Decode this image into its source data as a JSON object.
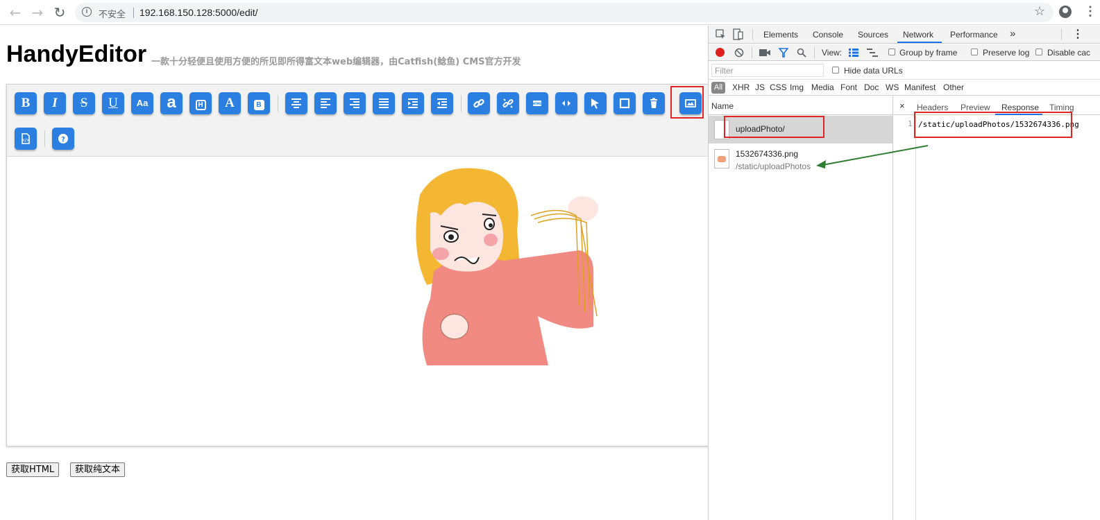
{
  "browser": {
    "url": "192.168.150.128:5000/edit/",
    "insecure_label": "不安全"
  },
  "page": {
    "title": "HandyEditor",
    "subtitle": "一款十分轻便且使用方便的所见即所得富文本web编辑器，由Catfish(鲶鱼) CMS官方开发",
    "buttons": {
      "get_html": "获取HTML",
      "get_text": "获取纯文本"
    },
    "toolbar": [
      {
        "name": "bold",
        "glyph": "B"
      },
      {
        "name": "italic",
        "glyph": "I"
      },
      {
        "name": "strikethrough",
        "glyph": "S"
      },
      {
        "name": "underline",
        "glyph": "U"
      },
      {
        "name": "font-size",
        "glyph": "Aa"
      },
      {
        "name": "font-family",
        "glyph": "a"
      },
      {
        "name": "heading",
        "glyph": "H"
      },
      {
        "name": "font-color",
        "glyph": "A"
      },
      {
        "name": "background-color",
        "glyph": "B"
      }
    ]
  },
  "devtools": {
    "tabs": [
      "Elements",
      "Console",
      "Sources",
      "Network",
      "Performance"
    ],
    "active_tab": "Network",
    "more_tabs": "»",
    "view_label": "View:",
    "group_by_frame": "Group by frame",
    "preserve_log": "Preserve log",
    "disable_cache": "Disable cac",
    "filter_placeholder": "Filter",
    "hide_data_urls": "Hide data URLs",
    "types": [
      "All",
      "XHR",
      "JS",
      "CSS",
      "Img",
      "Media",
      "Font",
      "Doc",
      "WS",
      "Manifest",
      "Other"
    ],
    "name_header": "Name",
    "requests": [
      {
        "name": "uploadPhoto/",
        "path": ""
      },
      {
        "name": "1532674336.png",
        "path": "/static/uploadPhotos"
      }
    ],
    "detail_tabs": [
      "Headers",
      "Preview",
      "Response",
      "Timing"
    ],
    "active_detail_tab": "Response",
    "close": "×",
    "response_line_number": "1",
    "response_text": "/static/uploadPhotos/1532674336.png"
  },
  "colors": {
    "toolbar_button": "#2b7fe0",
    "highlight": "#e02424",
    "arrow": "#2e7d32",
    "devtools_accent": "#1a73e8"
  }
}
